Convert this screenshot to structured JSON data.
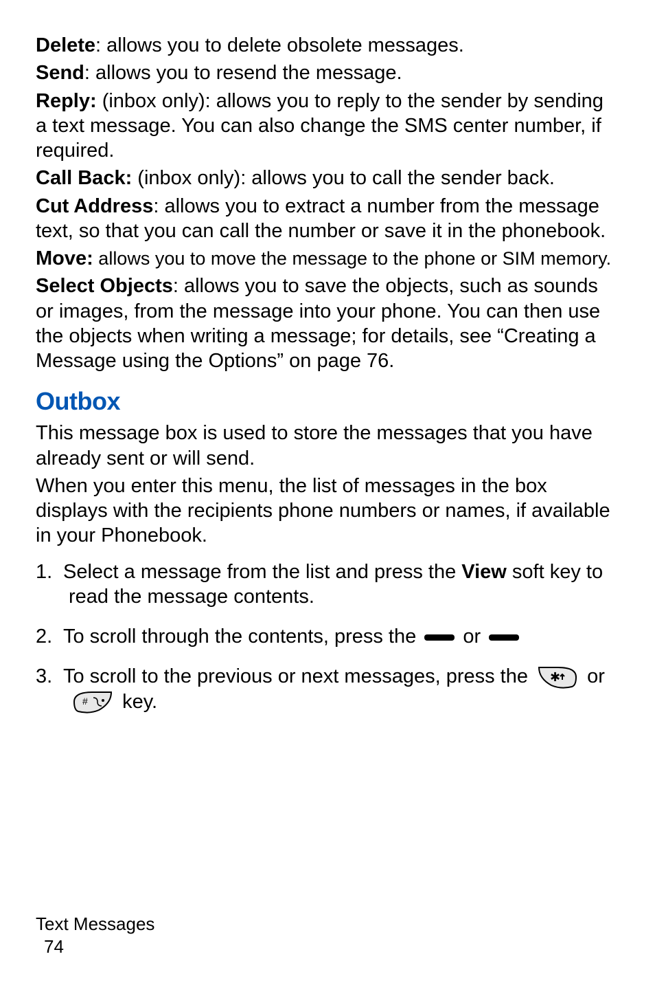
{
  "options": {
    "delete": {
      "term": "Delete",
      "desc": ": allows you to delete obsolete messages."
    },
    "send": {
      "term": "Send",
      "desc": ": allows you to resend the message."
    },
    "reply": {
      "term": "Reply:",
      "desc": " (inbox only): allows you to reply to the sender by sending a text message. You can also change the SMS center number, if required."
    },
    "callback": {
      "term": "Call Back:",
      "desc": " (inbox only): allows you to call the sender back."
    },
    "cutaddress": {
      "term": "Cut Address",
      "desc": ": allows you to extract a number from the message text, so that you can call the number or save it in the phonebook."
    },
    "move": {
      "term": "Move:",
      "desc": " allows you to move the message to the phone or SIM memory."
    },
    "selectobjects": {
      "term": "Select Objects",
      "desc": ": allows you to save the objects, such as sounds or images, from the message into your phone. You can then use the objects when writing a message; for details, see “Creating a Message using the Options” on page 76."
    }
  },
  "outbox": {
    "heading": "Outbox",
    "para1": "This message box is used to store the messages that you have already sent or will send.",
    "para2": "When you enter this menu, the list of messages in the box displays with the recipients phone numbers or names, if available in your Phonebook.",
    "step1_pre": "Select a message from the list and press the ",
    "step1_bold": "View",
    "step1_post": " soft key to read the message contents.",
    "step2_pre": "To scroll through the contents, press the ",
    "step2_mid": " or ",
    "step3_pre": "To scroll to the previous or next messages, press the ",
    "step3_or": " or ",
    "step3_key": " key."
  },
  "footer": {
    "title": "Text Messages",
    "page": "74"
  },
  "numbers": {
    "n1": "1.",
    "n2": "2.",
    "n3": "3."
  }
}
